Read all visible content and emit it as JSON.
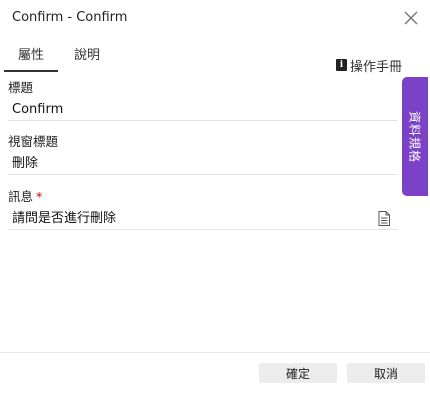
{
  "window": {
    "title": "Confirm - Confirm"
  },
  "tabs": [
    {
      "label": "屬性",
      "active": true
    },
    {
      "label": "說明",
      "active": false
    }
  ],
  "manual_link": {
    "label": "操作手冊",
    "icon": "info-icon"
  },
  "side_tab": {
    "label": "資料規格",
    "color": "#7b42c8"
  },
  "fields": [
    {
      "label": "標題",
      "value": "Confirm",
      "required": false
    },
    {
      "label": "視窗標題",
      "value": "刪除",
      "required": false
    },
    {
      "label": "訊息",
      "value": "請問是否進行刪除",
      "required": true,
      "required_mark": "*"
    }
  ],
  "buttons": {
    "ok": "確定",
    "cancel": "取消"
  }
}
